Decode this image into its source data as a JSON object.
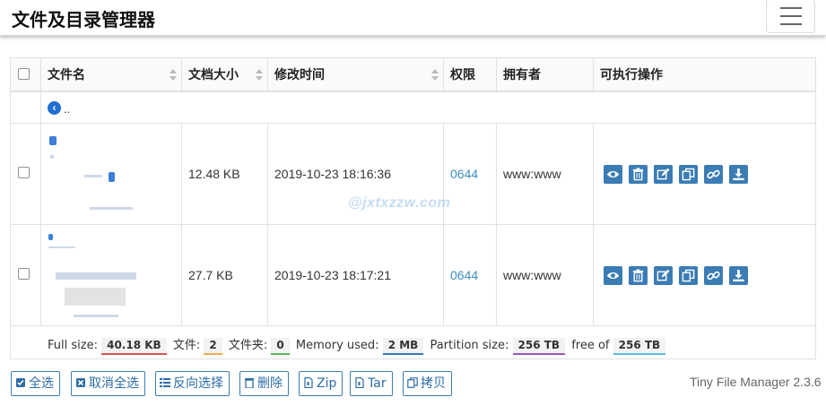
{
  "app": {
    "title": "文件及目录管理器",
    "version": "Tiny File Manager 2.3.6"
  },
  "table": {
    "headers": {
      "name": "文件名",
      "size": "文档大小",
      "modified": "修改时间",
      "perms": "权限",
      "owner": "拥有者",
      "actions": "可执行操作"
    },
    "parent_dir": "..",
    "rows": [
      {
        "size": "12.48 KB",
        "modified": "2019-10-23 18:16:36",
        "perms": "0644",
        "owner": "www:www"
      },
      {
        "size": "27.7 KB",
        "modified": "2019-10-23 18:17:21",
        "perms": "0644",
        "owner": "www:www"
      }
    ],
    "action_icons": [
      "eye-icon",
      "trash-icon",
      "edit-icon",
      "copy-icon",
      "link-icon",
      "download-icon"
    ]
  },
  "summary": {
    "full_size_label": "Full size:",
    "full_size": "40.18 KB",
    "files_label": "文件:",
    "files": "2",
    "folders_label": "文件夹:",
    "folders": "0",
    "memory_label": "Memory used:",
    "memory": "2 MB",
    "partition_label": "Partition size:",
    "partition": "256 TB",
    "free_label": "free of",
    "free": "256 TB"
  },
  "buttons": {
    "select_all": "全选",
    "unselect_all": "取消全选",
    "invert": "反向选择",
    "delete": "删除",
    "zip": "Zip",
    "tar": "Tar",
    "copy": "拷贝"
  },
  "watermark": "@jxtxzzw.com",
  "colors": {
    "accent": "#3c7cb4",
    "link": "#3c8dbc",
    "size_line": "#d9534f",
    "files_line": "#f0ad4e",
    "folders_line": "#5cb85c",
    "memory_line": "#337ab7",
    "partition_line": "#9b59b6",
    "free_line": "#5bc0de"
  }
}
